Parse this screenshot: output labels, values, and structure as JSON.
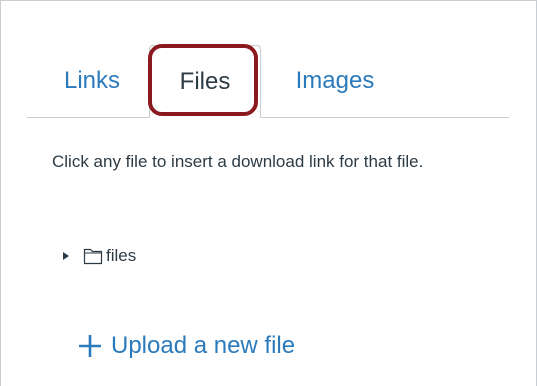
{
  "tabs": [
    {
      "label": "Links",
      "active": false
    },
    {
      "label": "Files",
      "active": true
    },
    {
      "label": "Images",
      "active": false
    }
  ],
  "instructions": "Click any file to insert a download link for that file.",
  "tree": {
    "folder_label": "files",
    "expanded": false,
    "folder_icon": "folder-icon"
  },
  "upload": {
    "label": "Upload a new file",
    "icon": "plus-icon"
  },
  "colors": {
    "link": "#2b7abc",
    "text": "#2d3b45",
    "highlight": "#8b1a1f",
    "border": "#c7cdd1"
  }
}
